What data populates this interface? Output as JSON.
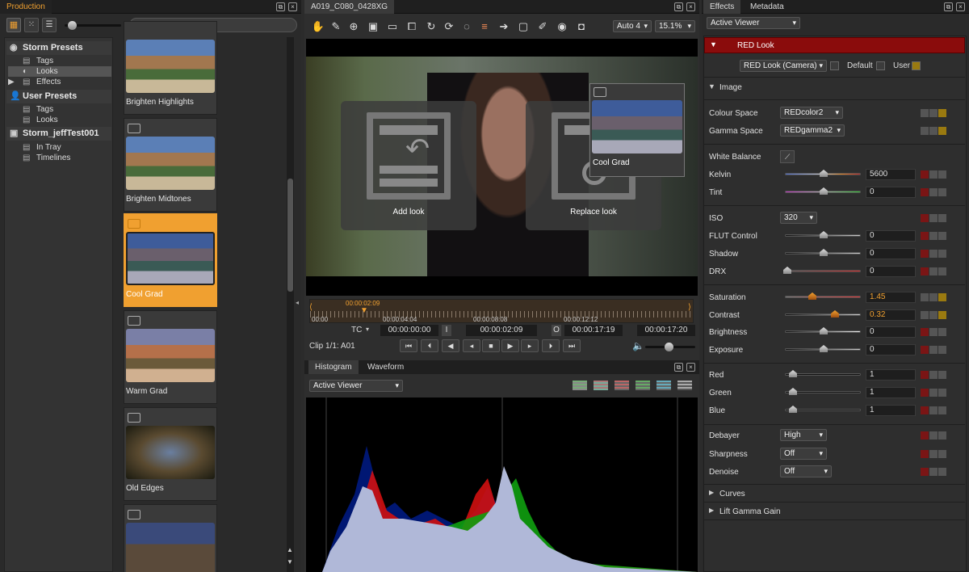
{
  "left_panel": {
    "tab": "Production",
    "tree": {
      "storm_presets": "Storm Presets",
      "tags": "Tags",
      "looks": "Looks",
      "effects": "Effects",
      "user_presets": "User Presets",
      "user_tags": "Tags",
      "user_looks": "Looks",
      "project": "Storm_jeffTest001",
      "in_tray": "In Tray",
      "timelines": "Timelines"
    },
    "looks": [
      "Brighten Highlights",
      "Brighten Midtones",
      "Cool Grad",
      "Warm Grad",
      "Old Edges",
      ""
    ]
  },
  "viewer": {
    "tab": "A019_C080_0428XG",
    "zoom_mode": "Auto 4",
    "zoom_pct": "15.1%",
    "drop_targets": {
      "add": "Add look",
      "replace": "Replace look"
    },
    "drag_tooltip": "Cool Grad",
    "timeline": {
      "playhead": "00:00:02:09",
      "start": "00:00",
      "ticks": [
        "00:00:04:04",
        "00:00:08:08",
        "00:00:12:12"
      ],
      "tc_mode": "TC",
      "tc_in": "00:00:00:00",
      "in_btn": "I",
      "tc_current": "00:00:02:09",
      "out_btn": "O",
      "tc_out": "00:00:17:19",
      "tc_end": "00:00:17:20",
      "clip_info": "Clip 1/1: A01"
    }
  },
  "scopes": {
    "tabs": [
      "Histogram",
      "Waveform"
    ],
    "source": "Active Viewer"
  },
  "effects": {
    "tabs": [
      "Effects",
      "Metadata"
    ],
    "source": "Active Viewer",
    "red_look": "RED Look",
    "look_preset": "RED Look (Camera)",
    "default_label": "Default",
    "user_label": "User",
    "image_section": "Image",
    "colour_space_label": "Colour Space",
    "colour_space": "REDcolor2",
    "gamma_space_label": "Gamma Space",
    "gamma_space": "REDgamma2",
    "white_balance": "White Balance",
    "kelvin_label": "Kelvin",
    "kelvin": "5600",
    "tint_label": "Tint",
    "tint": "0",
    "iso_label": "ISO",
    "iso": "320",
    "flut_label": "FLUT Control",
    "flut": "0",
    "shadow_label": "Shadow",
    "shadow": "0",
    "drx_label": "DRX",
    "drx": "0",
    "saturation_label": "Saturation",
    "saturation": "1.45",
    "contrast_label": "Contrast",
    "contrast": "0.32",
    "brightness_label": "Brightness",
    "brightness": "0",
    "exposure_label": "Exposure",
    "exposure": "0",
    "red_label": "Red",
    "red": "1",
    "green_label": "Green",
    "green": "1",
    "blue_label": "Blue",
    "blue": "1",
    "debayer_label": "Debayer",
    "debayer": "High",
    "sharpness_label": "Sharpness",
    "sharpness": "Off",
    "denoise_label": "Denoise",
    "denoise": "Off",
    "curves": "Curves",
    "lgg": "Lift Gamma Gain"
  }
}
